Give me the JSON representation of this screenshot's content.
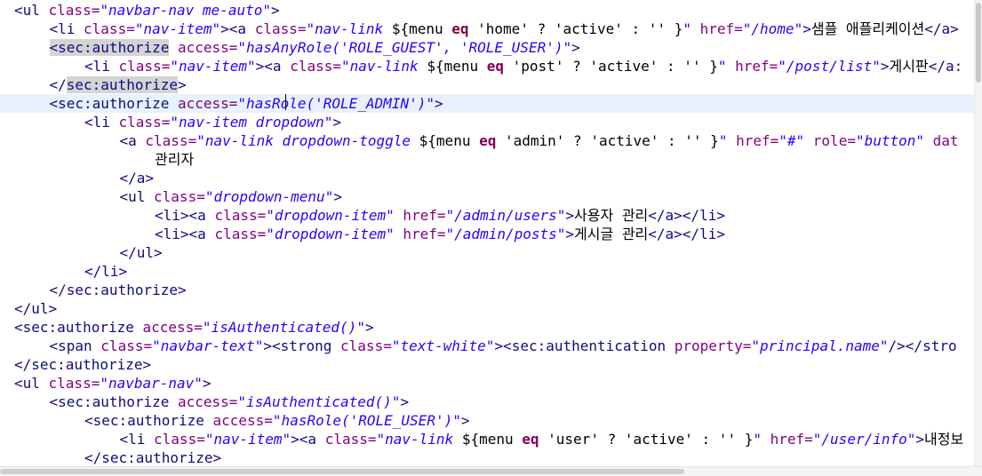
{
  "editor": {
    "current_line_index": 5,
    "lines": [
      {
        "indent": 1,
        "segments": [
          {
            "c": "t-tag",
            "t": "<ul "
          },
          {
            "c": "t-attr",
            "t": "class="
          },
          {
            "c": "t-val",
            "t": "\"navbar-nav me-auto\""
          },
          {
            "c": "t-tag",
            "t": ">"
          }
        ]
      },
      {
        "indent": 2,
        "segments": [
          {
            "c": "t-tag",
            "t": "<li "
          },
          {
            "c": "t-attr",
            "t": "class="
          },
          {
            "c": "t-val",
            "t": "\"nav-item\""
          },
          {
            "c": "t-tag",
            "t": "><a "
          },
          {
            "c": "t-attr",
            "t": "class="
          },
          {
            "c": "t-val",
            "t": "\"nav-link "
          },
          {
            "c": "t-text",
            "t": "${menu "
          },
          {
            "c": "t-kw",
            "t": "eq"
          },
          {
            "c": "t-text",
            "t": " 'home' ? 'active' : '' }"
          },
          {
            "c": "t-val",
            "t": "\""
          },
          {
            "c": "t-attr",
            "t": " href="
          },
          {
            "c": "t-val",
            "t": "\"/home\""
          },
          {
            "c": "t-tag",
            "t": ">"
          },
          {
            "c": "t-text",
            "t": "샘플 애플리케이션"
          },
          {
            "c": "t-tag",
            "t": "</a>"
          }
        ]
      },
      {
        "indent": 2,
        "segments": [
          {
            "c": "t-tag hl",
            "t": "<sec:authorize"
          },
          {
            "c": "t-attr",
            "t": " access="
          },
          {
            "c": "t-val",
            "t": "\"hasAnyRole('ROLE_GUEST', 'ROLE_USER')\""
          },
          {
            "c": "t-tag",
            "t": ">"
          }
        ]
      },
      {
        "indent": 3,
        "segments": [
          {
            "c": "t-tag",
            "t": "<li "
          },
          {
            "c": "t-attr",
            "t": "class="
          },
          {
            "c": "t-val",
            "t": "\"nav-item\""
          },
          {
            "c": "t-tag",
            "t": "><a "
          },
          {
            "c": "t-attr",
            "t": "class="
          },
          {
            "c": "t-val",
            "t": "\"nav-link "
          },
          {
            "c": "t-text",
            "t": "${menu "
          },
          {
            "c": "t-kw",
            "t": "eq"
          },
          {
            "c": "t-text",
            "t": " 'post' ? 'active' : '' }"
          },
          {
            "c": "t-val",
            "t": "\""
          },
          {
            "c": "t-attr",
            "t": " href="
          },
          {
            "c": "t-val",
            "t": "\"/post/list\""
          },
          {
            "c": "t-tag",
            "t": ">"
          },
          {
            "c": "t-text",
            "t": "게시판"
          },
          {
            "c": "t-tag",
            "t": "</a:"
          }
        ]
      },
      {
        "indent": 2,
        "segments": [
          {
            "c": "t-tag",
            "t": "</"
          },
          {
            "c": "t-tag hl",
            "t": "sec:authorize"
          },
          {
            "c": "t-tag",
            "t": ">"
          }
        ]
      },
      {
        "indent": 2,
        "segments": [
          {
            "c": "t-tag",
            "t": "<sec:authorize"
          },
          {
            "c": "t-attr",
            "t": " access="
          },
          {
            "c": "t-val",
            "t": "\"hasRole('ROLE_ADMIN')\""
          },
          {
            "c": "t-tag",
            "t": ">"
          }
        ]
      },
      {
        "indent": 3,
        "segments": [
          {
            "c": "t-tag",
            "t": "<li "
          },
          {
            "c": "t-attr",
            "t": "class="
          },
          {
            "c": "t-val",
            "t": "\"nav-item dropdown\""
          },
          {
            "c": "t-tag",
            "t": ">"
          }
        ]
      },
      {
        "indent": 4,
        "segments": [
          {
            "c": "t-tag",
            "t": "<a "
          },
          {
            "c": "t-attr",
            "t": "class="
          },
          {
            "c": "t-val",
            "t": "\"nav-link dropdown-toggle "
          },
          {
            "c": "t-text",
            "t": "${menu "
          },
          {
            "c": "t-kw",
            "t": "eq"
          },
          {
            "c": "t-text",
            "t": " 'admin' ? 'active' : '' }"
          },
          {
            "c": "t-val",
            "t": "\""
          },
          {
            "c": "t-attr",
            "t": " href="
          },
          {
            "c": "t-val",
            "t": "\"#\""
          },
          {
            "c": "t-attr",
            "t": " role="
          },
          {
            "c": "t-val",
            "t": "\"button\""
          },
          {
            "c": "t-attr",
            "t": " dat"
          }
        ]
      },
      {
        "indent": 5,
        "segments": [
          {
            "c": "t-text",
            "t": "관리자"
          }
        ]
      },
      {
        "indent": 4,
        "segments": [
          {
            "c": "t-tag",
            "t": "</a>"
          }
        ]
      },
      {
        "indent": 4,
        "segments": [
          {
            "c": "t-tag",
            "t": "<ul "
          },
          {
            "c": "t-attr",
            "t": "class="
          },
          {
            "c": "t-val",
            "t": "\"dropdown-menu\""
          },
          {
            "c": "t-tag",
            "t": ">"
          }
        ]
      },
      {
        "indent": 5,
        "segments": [
          {
            "c": "t-tag",
            "t": "<li><a "
          },
          {
            "c": "t-attr",
            "t": "class="
          },
          {
            "c": "t-val",
            "t": "\"dropdown-item\""
          },
          {
            "c": "t-attr",
            "t": " href="
          },
          {
            "c": "t-val",
            "t": "\"/admin/users\""
          },
          {
            "c": "t-tag",
            "t": ">"
          },
          {
            "c": "t-text",
            "t": "사용자 관리"
          },
          {
            "c": "t-tag",
            "t": "</a></li>"
          }
        ]
      },
      {
        "indent": 5,
        "segments": [
          {
            "c": "t-tag",
            "t": "<li><a "
          },
          {
            "c": "t-attr",
            "t": "class="
          },
          {
            "c": "t-val",
            "t": "\"dropdown-item\""
          },
          {
            "c": "t-attr",
            "t": " href="
          },
          {
            "c": "t-val",
            "t": "\"/admin/posts\""
          },
          {
            "c": "t-tag",
            "t": ">"
          },
          {
            "c": "t-text",
            "t": "게시글 관리"
          },
          {
            "c": "t-tag",
            "t": "</a></li>"
          }
        ]
      },
      {
        "indent": 4,
        "segments": [
          {
            "c": "t-tag",
            "t": "</ul>"
          }
        ]
      },
      {
        "indent": 3,
        "segments": [
          {
            "c": "t-tag",
            "t": "</li>"
          }
        ]
      },
      {
        "indent": 2,
        "segments": [
          {
            "c": "t-tag",
            "t": "</sec:authorize>"
          }
        ]
      },
      {
        "indent": 1,
        "segments": [
          {
            "c": "t-tag",
            "t": "</ul>"
          }
        ]
      },
      {
        "indent": 1,
        "segments": [
          {
            "c": "t-tag",
            "t": "<sec:authorize"
          },
          {
            "c": "t-attr",
            "t": " access="
          },
          {
            "c": "t-val",
            "t": "\"isAuthenticated()\""
          },
          {
            "c": "t-tag",
            "t": ">"
          }
        ]
      },
      {
        "indent": 2,
        "segments": [
          {
            "c": "t-tag",
            "t": "<span "
          },
          {
            "c": "t-attr",
            "t": "class="
          },
          {
            "c": "t-val",
            "t": "\"navbar-text\""
          },
          {
            "c": "t-tag",
            "t": "><strong "
          },
          {
            "c": "t-attr",
            "t": "class="
          },
          {
            "c": "t-val",
            "t": "\"text-white\""
          },
          {
            "c": "t-tag",
            "t": "><sec:authentication"
          },
          {
            "c": "t-attr",
            "t": " property="
          },
          {
            "c": "t-val",
            "t": "\"principal.name\""
          },
          {
            "c": "t-tag",
            "t": "/></stro"
          }
        ]
      },
      {
        "indent": 1,
        "segments": [
          {
            "c": "t-tag",
            "t": "</sec:authorize>"
          }
        ]
      },
      {
        "indent": 1,
        "segments": [
          {
            "c": "t-tag",
            "t": "<ul "
          },
          {
            "c": "t-attr",
            "t": "class="
          },
          {
            "c": "t-val",
            "t": "\"navbar-nav\""
          },
          {
            "c": "t-tag",
            "t": ">"
          }
        ]
      },
      {
        "indent": 2,
        "segments": [
          {
            "c": "t-tag",
            "t": "<sec:authorize"
          },
          {
            "c": "t-attr",
            "t": " access="
          },
          {
            "c": "t-val",
            "t": "\"isAuthenticated()\""
          },
          {
            "c": "t-tag",
            "t": ">"
          }
        ]
      },
      {
        "indent": 3,
        "segments": [
          {
            "c": "t-tag",
            "t": "<sec:authorize"
          },
          {
            "c": "t-attr",
            "t": " access="
          },
          {
            "c": "t-val",
            "t": "\"hasRole('ROLE_USER')\""
          },
          {
            "c": "t-tag",
            "t": ">"
          }
        ]
      },
      {
        "indent": 4,
        "segments": [
          {
            "c": "t-tag",
            "t": "<li "
          },
          {
            "c": "t-attr",
            "t": "class="
          },
          {
            "c": "t-val",
            "t": "\"nav-item\""
          },
          {
            "c": "t-tag",
            "t": "><a "
          },
          {
            "c": "t-attr",
            "t": "class="
          },
          {
            "c": "t-val",
            "t": "\"nav-link "
          },
          {
            "c": "t-text",
            "t": "${menu "
          },
          {
            "c": "t-kw",
            "t": "eq"
          },
          {
            "c": "t-text",
            "t": " 'user' ? 'active' : '' }"
          },
          {
            "c": "t-val",
            "t": "\""
          },
          {
            "c": "t-attr",
            "t": " href="
          },
          {
            "c": "t-val",
            "t": "\"/user/info\""
          },
          {
            "c": "t-tag",
            "t": ">"
          },
          {
            "c": "t-text",
            "t": "내정보"
          }
        ]
      },
      {
        "indent": 3,
        "segments": [
          {
            "c": "t-tag",
            "t": "</sec:authorize>"
          }
        ]
      }
    ]
  }
}
